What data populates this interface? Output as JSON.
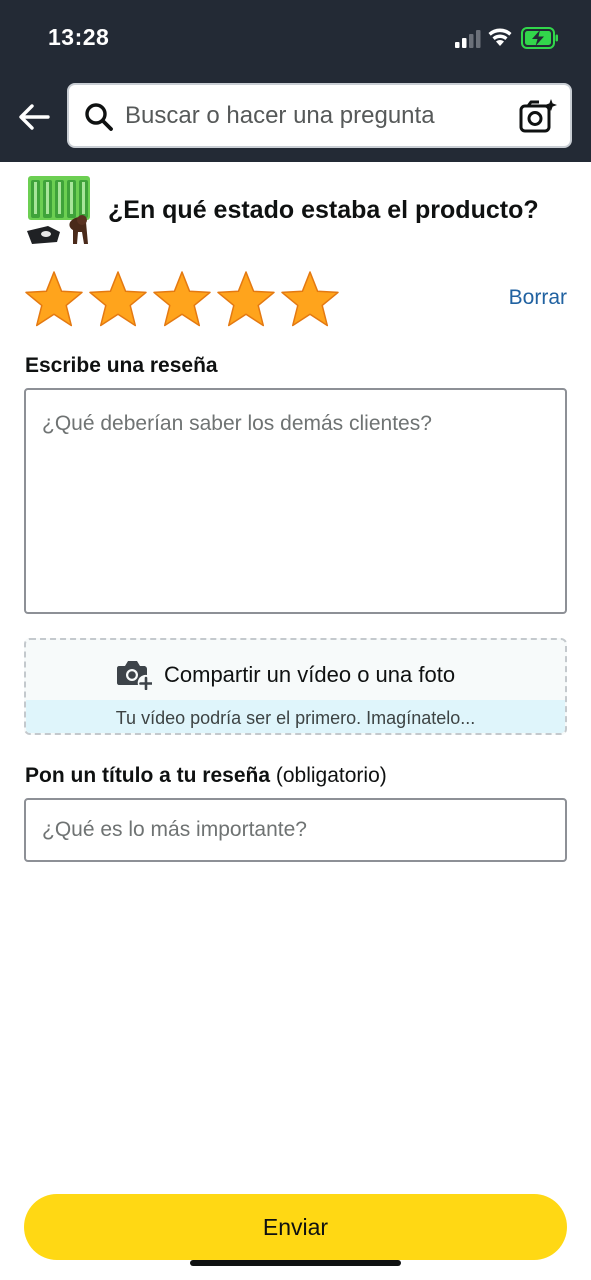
{
  "status_bar": {
    "time": "13:28"
  },
  "search": {
    "placeholder": "Buscar o hacer una pregunta"
  },
  "product": {
    "question": "¿En qué estado estaba el producto?"
  },
  "rating": {
    "value": 5,
    "max": 5,
    "star_color": "#ffa41c",
    "clear_label": "Borrar"
  },
  "review": {
    "label": "Escribe una reseña",
    "placeholder": "¿Qué deberían saber los demás clientes?"
  },
  "media": {
    "label": "Compartir un vídeo o una foto",
    "hint": "Tu vídeo podría ser el primero. Imagínatelo..."
  },
  "review_title": {
    "label_bold": "Pon un título a tu reseña",
    "label_suffix": "(obligatorio)",
    "placeholder": "¿Qué es lo más importante?"
  },
  "submit": {
    "label": "Enviar"
  },
  "colors": {
    "header_bg": "#232a35",
    "link": "#2162a1",
    "button": "#ffd814",
    "battery": "#32d74b"
  }
}
